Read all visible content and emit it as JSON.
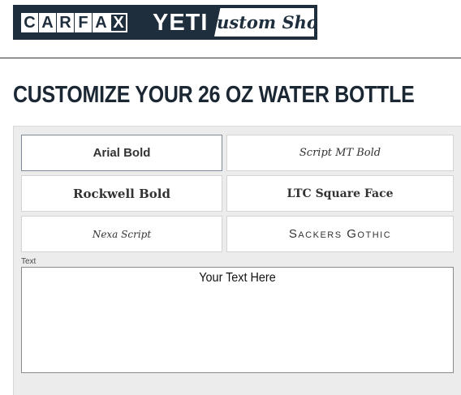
{
  "brand": {
    "carfax_letters": [
      "C",
      "A",
      "R",
      "F",
      "A",
      "X"
    ],
    "partner": "YETI",
    "shop": "Custom Shop"
  },
  "page": {
    "title": "CUSTOMIZE YOUR 26 OZ WATER BOTTLE"
  },
  "font_options": [
    {
      "label": "Arial Bold",
      "selected": true
    },
    {
      "label": "Script MT Bold",
      "selected": false
    },
    {
      "label": "Rockwell Bold",
      "selected": false
    },
    {
      "label": "LTC Square Face",
      "selected": false
    },
    {
      "label": "Nexa Script",
      "selected": false
    },
    {
      "label": "Sackers Gothic",
      "selected": false
    }
  ],
  "text_field": {
    "label": "Text",
    "value": "Your Text Here"
  },
  "colors": {
    "brand_navy": "#1e2e3c",
    "panel_bg": "#ececec",
    "selected_border": "#7d8a97"
  }
}
